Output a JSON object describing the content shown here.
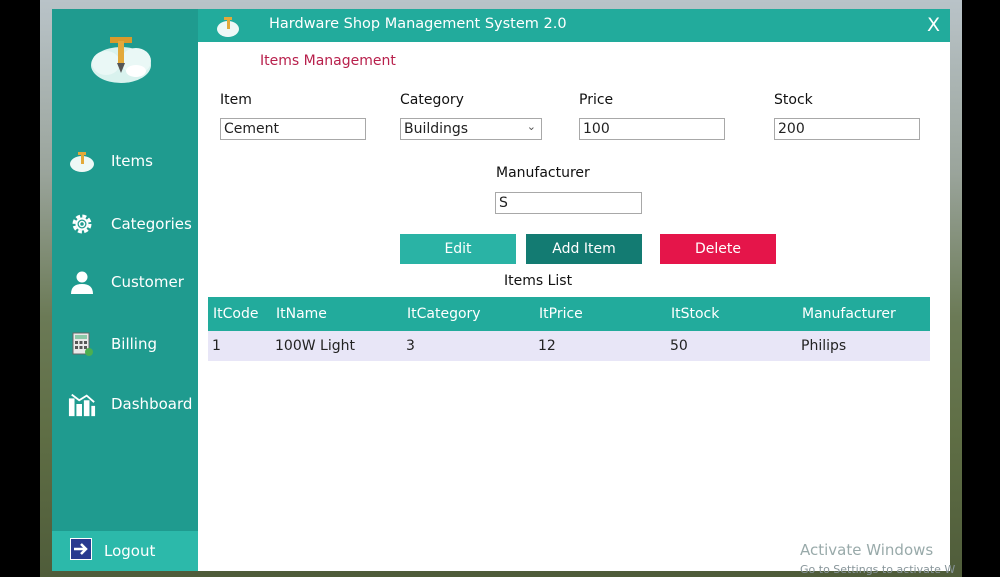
{
  "window": {
    "title": "Hardware Shop Management System 2.0",
    "close_label": "X"
  },
  "sidebar": {
    "items": [
      {
        "label": "Items",
        "icon": "items-icon"
      },
      {
        "label": "Categories",
        "icon": "gear-icon"
      },
      {
        "label": "Customer",
        "icon": "user-icon"
      },
      {
        "label": "Billing",
        "icon": "calculator-icon"
      },
      {
        "label": "Dashboard",
        "icon": "chart-icon"
      }
    ],
    "logout_label": "Logout"
  },
  "form": {
    "section_title": "Items Management",
    "item_label": "Item",
    "item_value": "Cement",
    "category_label": "Category",
    "category_value": "Buildings",
    "price_label": "Price",
    "price_value": "100",
    "stock_label": "Stock",
    "stock_value": "200",
    "manufacturer_label": "Manufacturer",
    "manufacturer_value": "S"
  },
  "buttons": {
    "edit": "Edit",
    "add": "Add Item",
    "delete": "Delete"
  },
  "list": {
    "title": "Items List",
    "columns": [
      "ItCode",
      "ItName",
      "ItCategory",
      "ItPrice",
      "ItStock",
      "Manufacturer"
    ],
    "rows": [
      [
        "1",
        "100W Light",
        "3",
        "12",
        "50",
        "Philips"
      ]
    ]
  },
  "colors": {
    "sidebar": "#1f9b8f",
    "titlebar": "#22ab9c",
    "edit_button": "#2ab3a5",
    "add_button": "#137b72",
    "delete_button": "#e5154a",
    "section_title": "#b8204c"
  },
  "watermark": {
    "line1": "Activate Windows",
    "line2": "Go to Settings to activate W"
  }
}
